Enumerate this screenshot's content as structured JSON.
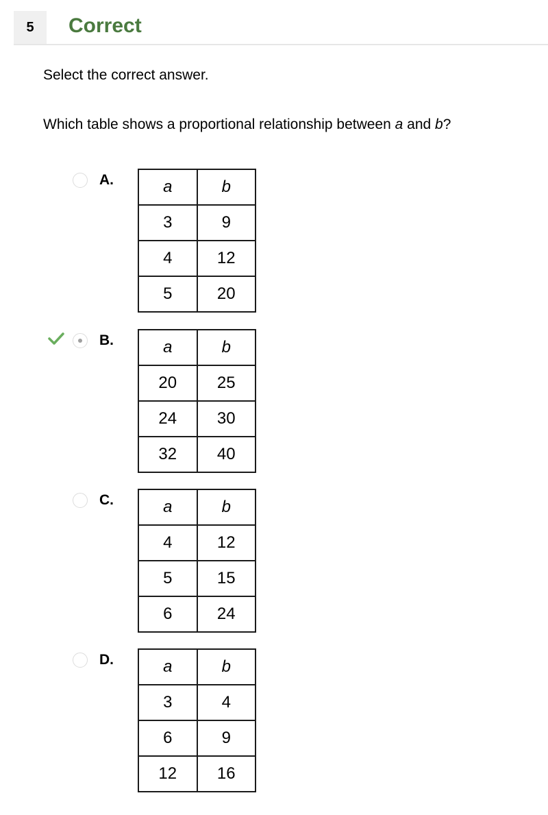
{
  "header": {
    "question_number": "5",
    "status": "Correct",
    "status_color": "#4a7a3f"
  },
  "instruction": "Select the correct answer.",
  "question": {
    "prefix": "Which table shows a proportional relationship between ",
    "var_a": "a",
    "middle": " and ",
    "var_b": "b",
    "suffix": "?"
  },
  "options": [
    {
      "letter": "A.",
      "selected": false,
      "correct_mark": false,
      "headers": [
        "a",
        "b"
      ],
      "rows": [
        [
          "3",
          "9"
        ],
        [
          "4",
          "12"
        ],
        [
          "5",
          "20"
        ]
      ]
    },
    {
      "letter": "B.",
      "selected": true,
      "correct_mark": true,
      "headers": [
        "a",
        "b"
      ],
      "rows": [
        [
          "20",
          "25"
        ],
        [
          "24",
          "30"
        ],
        [
          "32",
          "40"
        ]
      ]
    },
    {
      "letter": "C.",
      "selected": false,
      "correct_mark": false,
      "headers": [
        "a",
        "b"
      ],
      "rows": [
        [
          "4",
          "12"
        ],
        [
          "5",
          "15"
        ],
        [
          "6",
          "24"
        ]
      ]
    },
    {
      "letter": "D.",
      "selected": false,
      "correct_mark": false,
      "headers": [
        "a",
        "b"
      ],
      "rows": [
        [
          "3",
          "4"
        ],
        [
          "6",
          "9"
        ],
        [
          "12",
          "16"
        ]
      ]
    }
  ],
  "icons": {
    "correct": "checkmark-icon",
    "radio": "radio-button"
  }
}
